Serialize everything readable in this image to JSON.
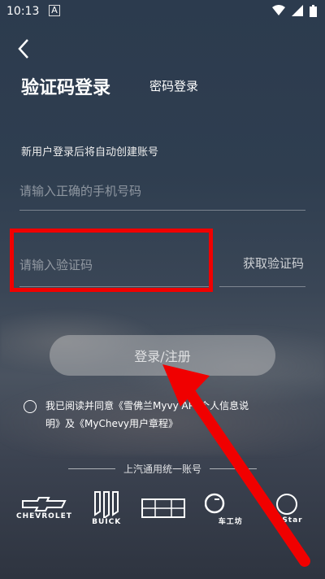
{
  "status": {
    "time": "10:13",
    "sim_label": "A"
  },
  "header": {
    "active_tab": "验证码登录",
    "password_tab": "密码登录"
  },
  "form": {
    "hint": "新用户登录后将自动创建账号",
    "phone_placeholder": "请输入正确的手机号码",
    "code_placeholder": "请输入验证码",
    "get_code": "获取验证码"
  },
  "login_button": "登录/注册",
  "agreement": {
    "prefix": "我已阅读并同意《雪佛兰My",
    "mid": "vy APP个人信息说",
    "suffix": "明》及《MyChevy用户章程》"
  },
  "divider": "上汽通用统一账号",
  "brands": [
    {
      "icon": "chevrolet-logo-icon",
      "label": "CHEVROLET"
    },
    {
      "icon": "buick-logo-icon",
      "label": "BUICK"
    },
    {
      "icon": "cadillac-logo-icon",
      "label": ""
    },
    {
      "icon": "chegongfang-logo-icon",
      "label": "车工坊"
    },
    {
      "icon": "onstar-logo-icon",
      "label": "Star"
    }
  ],
  "colors": {
    "highlight": "#f00000",
    "button": "#c8c8c8"
  }
}
